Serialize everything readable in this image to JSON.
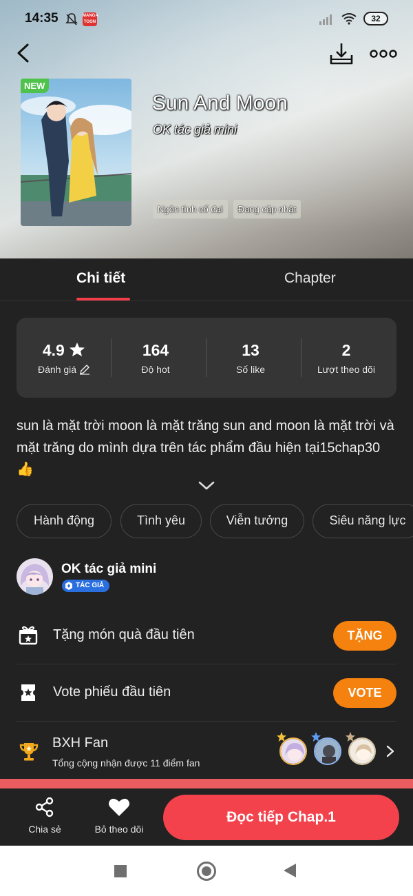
{
  "status_bar": {
    "time": "14:35",
    "app_badge": "MANGA TOON",
    "battery": "32"
  },
  "header": {
    "new_badge": "NEW",
    "title": "Sun And Moon",
    "author": "OK tác giả mini",
    "tags": [
      "Ngôn tình cổ đại",
      "Đang cập nhật"
    ]
  },
  "tabs": [
    {
      "label": "Chi tiết",
      "active": true
    },
    {
      "label": "Chapter",
      "active": false
    }
  ],
  "stats": [
    {
      "value": "4.9",
      "label": "Đánh giá"
    },
    {
      "value": "164",
      "label": "Độ hot"
    },
    {
      "value": "13",
      "label": "Số like"
    },
    {
      "value": "2",
      "label": "Lượt theo dõi"
    }
  ],
  "description": "sun là mặt trời moon là mặt trăng sun and moon là mặt trời và mặt trăng do mình dựa trên tác phẩm đầu hiện tại15chap30👍",
  "genres": [
    "Hành động",
    "Tình yêu",
    "Viễn tưởng",
    "Siêu năng lực"
  ],
  "author_section": {
    "name": "OK tác giả mini",
    "badge": "TÁC GIẢ"
  },
  "gift_row": {
    "text": "Tặng món quà đầu tiên",
    "button": "TẶNG"
  },
  "vote_row": {
    "text": "Vote phiếu đầu tiên",
    "button": "VOTE"
  },
  "fan_rank": {
    "title": "BXH Fan",
    "subtitle": "Tổng cộng nhận được 11 điểm fan"
  },
  "bottom_bar": {
    "share": "Chia sẻ",
    "unfollow": "Bỏ theo dõi",
    "read": "Đọc tiếp Chap.1"
  },
  "colors": {
    "accent_red": "#f4424d",
    "accent_orange": "#f5820f",
    "badge_green": "#4ec24b",
    "author_badge_blue": "#2a6fe0"
  },
  "icons": [
    "back-arrow-icon",
    "download-icon",
    "more-icon",
    "star-icon",
    "edit-icon",
    "chevron-down-icon",
    "gift-icon",
    "ticket-icon",
    "trophy-icon",
    "chevron-right-icon",
    "share-icon",
    "heart-icon"
  ]
}
